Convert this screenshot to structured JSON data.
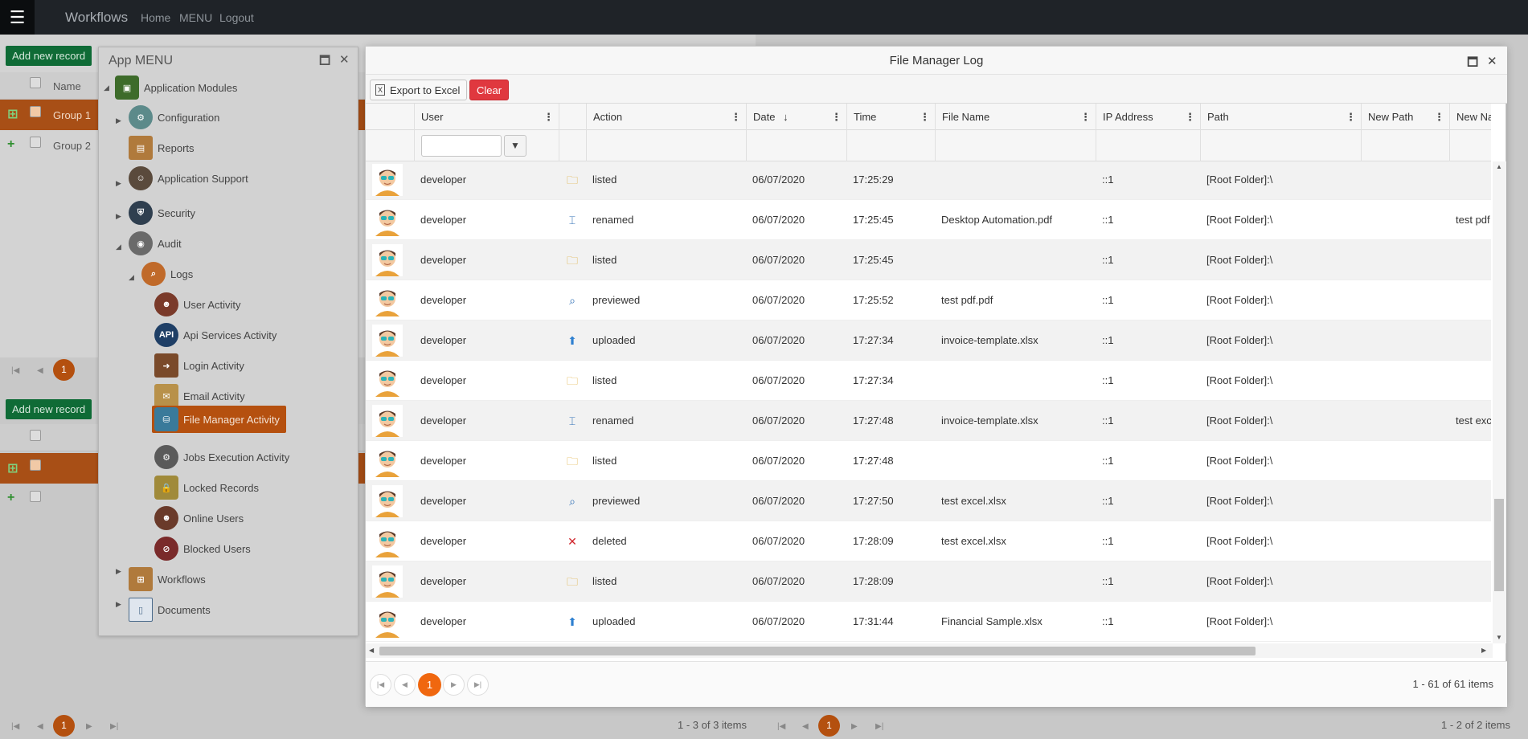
{
  "navbar": {
    "menu_glyph": "☰",
    "brand": "Workflows",
    "links": [
      "Home",
      "MENU",
      "Logout"
    ]
  },
  "background": {
    "add_new_record": "Add new record",
    "name_header": "Name",
    "groups": [
      "Group 1",
      "Group 2"
    ],
    "left_pager_info": "1 - 3 of 3 items",
    "right_pager_info": "1 - 2 of 2 items",
    "page": "1"
  },
  "app_menu": {
    "title": "App MENU",
    "items": [
      {
        "label": "Application Modules",
        "icon": "cube-icon"
      },
      {
        "label": "Configuration",
        "icon": "gear-icon"
      },
      {
        "label": "Reports",
        "icon": "report-icon"
      },
      {
        "label": "Application Support",
        "icon": "support-icon"
      },
      {
        "label": "Security",
        "icon": "shield-icon"
      },
      {
        "label": "Audit",
        "icon": "eye-icon"
      },
      {
        "label": "Logs",
        "icon": "magnifier-icon"
      },
      {
        "label": "User Activity",
        "icon": "user-icon"
      },
      {
        "label": "Api Services Activity",
        "icon": "api-icon"
      },
      {
        "label": "Login Activity",
        "icon": "door-icon"
      },
      {
        "label": "Email Activity",
        "icon": "envelope-icon"
      },
      {
        "label": "File Manager Activity",
        "icon": "database-icon"
      },
      {
        "label": "Jobs Execution Activity",
        "icon": "gears-icon"
      },
      {
        "label": "Locked Records",
        "icon": "lock-icon"
      },
      {
        "label": "Online Users",
        "icon": "online-user-icon"
      },
      {
        "label": "Blocked Users",
        "icon": "blocked-user-icon"
      },
      {
        "label": "Workflows",
        "icon": "workflow-icon"
      },
      {
        "label": "Documents",
        "icon": "document-icon"
      }
    ]
  },
  "modal": {
    "title": "File Manager Log",
    "toolbar": {
      "export_label": "Export to Excel",
      "clear_label": "Clear"
    },
    "columns": [
      "",
      "User",
      "",
      "Action",
      "Date",
      "Time",
      "File Name",
      "IP Address",
      "Path",
      "New Path",
      "New Na"
    ],
    "rows": [
      {
        "user": "developer",
        "action": "listed",
        "icon": "folder-search-icon",
        "date": "06/07/2020",
        "time": "17:25:29",
        "file": "",
        "ip": "::1",
        "path": "[Root Folder]:\\",
        "new_path": "",
        "new_name": ""
      },
      {
        "user": "developer",
        "action": "renamed",
        "icon": "rename-icon",
        "date": "06/07/2020",
        "time": "17:25:45",
        "file": "Desktop Automation.pdf",
        "ip": "::1",
        "path": "[Root Folder]:\\",
        "new_path": "",
        "new_name": "test pdf"
      },
      {
        "user": "developer",
        "action": "listed",
        "icon": "folder-search-icon",
        "date": "06/07/2020",
        "time": "17:25:45",
        "file": "",
        "ip": "::1",
        "path": "[Root Folder]:\\",
        "new_path": "",
        "new_name": ""
      },
      {
        "user": "developer",
        "action": "previewed",
        "icon": "preview-icon",
        "date": "06/07/2020",
        "time": "17:25:52",
        "file": "test pdf.pdf",
        "ip": "::1",
        "path": "[Root Folder]:\\",
        "new_path": "",
        "new_name": ""
      },
      {
        "user": "developer",
        "action": "uploaded",
        "icon": "upload-arrow-icon",
        "date": "06/07/2020",
        "time": "17:27:34",
        "file": "invoice-template.xlsx",
        "ip": "::1",
        "path": "[Root Folder]:\\",
        "new_path": "",
        "new_name": ""
      },
      {
        "user": "developer",
        "action": "listed",
        "icon": "folder-search-icon",
        "date": "06/07/2020",
        "time": "17:27:34",
        "file": "",
        "ip": "::1",
        "path": "[Root Folder]:\\",
        "new_path": "",
        "new_name": ""
      },
      {
        "user": "developer",
        "action": "renamed",
        "icon": "rename-icon",
        "date": "06/07/2020",
        "time": "17:27:48",
        "file": "invoice-template.xlsx",
        "ip": "::1",
        "path": "[Root Folder]:\\",
        "new_path": "",
        "new_name": "test exc"
      },
      {
        "user": "developer",
        "action": "listed",
        "icon": "folder-search-icon",
        "date": "06/07/2020",
        "time": "17:27:48",
        "file": "",
        "ip": "::1",
        "path": "[Root Folder]:\\",
        "new_path": "",
        "new_name": ""
      },
      {
        "user": "developer",
        "action": "previewed",
        "icon": "preview-icon",
        "date": "06/07/2020",
        "time": "17:27:50",
        "file": "test excel.xlsx",
        "ip": "::1",
        "path": "[Root Folder]:\\",
        "new_path": "",
        "new_name": ""
      },
      {
        "user": "developer",
        "action": "deleted",
        "icon": "delete-x-icon",
        "date": "06/07/2020",
        "time": "17:28:09",
        "file": "test excel.xlsx",
        "ip": "::1",
        "path": "[Root Folder]:\\",
        "new_path": "",
        "new_name": ""
      },
      {
        "user": "developer",
        "action": "listed",
        "icon": "folder-search-icon",
        "date": "06/07/2020",
        "time": "17:28:09",
        "file": "",
        "ip": "::1",
        "path": "[Root Folder]:\\",
        "new_path": "",
        "new_name": ""
      },
      {
        "user": "developer",
        "action": "uploaded",
        "icon": "upload-arrow-icon",
        "date": "06/07/2020",
        "time": "17:31:44",
        "file": "Financial Sample.xlsx",
        "ip": "::1",
        "path": "[Root Folder]:\\",
        "new_path": "",
        "new_name": ""
      }
    ],
    "pager": {
      "page": "1",
      "info": "1 - 61 of 61 items"
    }
  },
  "colors": {
    "accent": "#f0670f",
    "clear_button": "#e0383f",
    "navbar": "#1f2328",
    "add_button": "#0f6b36"
  }
}
